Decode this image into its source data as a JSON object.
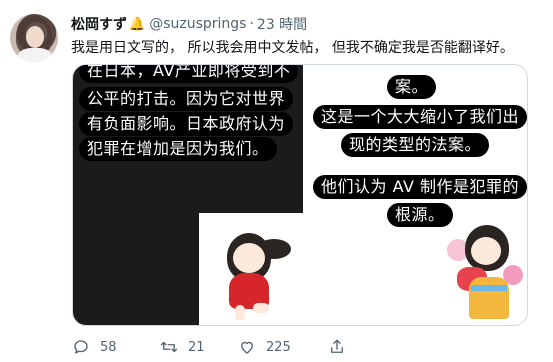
{
  "tweet": {
    "author_name": "松岡すず",
    "author_badge": "🔔",
    "handle": "@suzusprings",
    "separator": "·",
    "time": "23 時間",
    "text": "我是用日文写的， 所以我会用中文发帖， 但我不确定我是否能翻译好。"
  },
  "media": {
    "left_captions": [
      "在日本，AV产业即将受到不",
      "公平的打击。因为它对世界",
      "有负面影响。日本政府认为",
      "犯罪在增加是因为我们。"
    ],
    "right_captions": [
      "案。",
      "这是一个大大缩小了我们出",
      "现的类型的法案。",
      "他们认为 AV 制作是犯罪的",
      "根源。"
    ]
  },
  "actions": {
    "reply_count": "58",
    "retweet_count": "21",
    "like_count": "225"
  },
  "icons": {
    "reply": "reply-icon",
    "retweet": "retweet-icon",
    "like": "like-icon",
    "share": "share-icon"
  }
}
